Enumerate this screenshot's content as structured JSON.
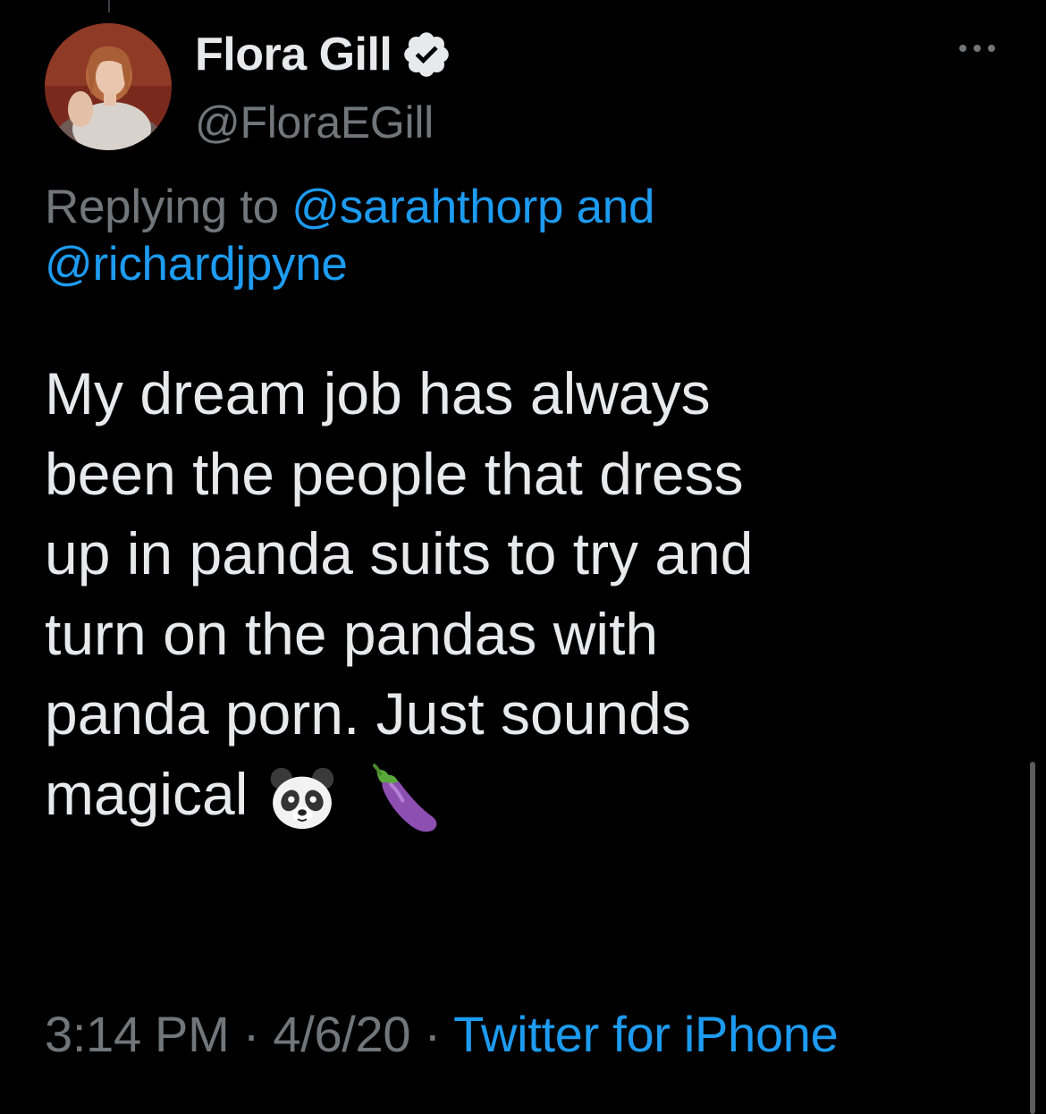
{
  "tweet": {
    "author": {
      "display_name": "Flora Gill",
      "handle": "@FloraEGill",
      "verified": true,
      "avatar_icon": "profile-photo"
    },
    "more_icon": "more-options-icon",
    "reply": {
      "prefix": "Replying to",
      "mention_1": "@sarahthorp",
      "conjunction": "and",
      "mention_2": "@richardjpyne"
    },
    "text_lines": [
      "My dream job has always",
      "been the people that dress",
      "up in panda suits to try and",
      "turn on the pandas with",
      "panda porn. Just sounds",
      "magical"
    ],
    "emojis": [
      "panda-face-emoji",
      "eggplant-emoji"
    ],
    "time": "3:14 PM",
    "date": "4/6/20",
    "separator": "·",
    "source": "Twitter for iPhone"
  },
  "colors": {
    "background": "#000000",
    "text_primary": "#e7e9ea",
    "text_secondary": "#71767b",
    "accent": "#1d9bf0"
  }
}
